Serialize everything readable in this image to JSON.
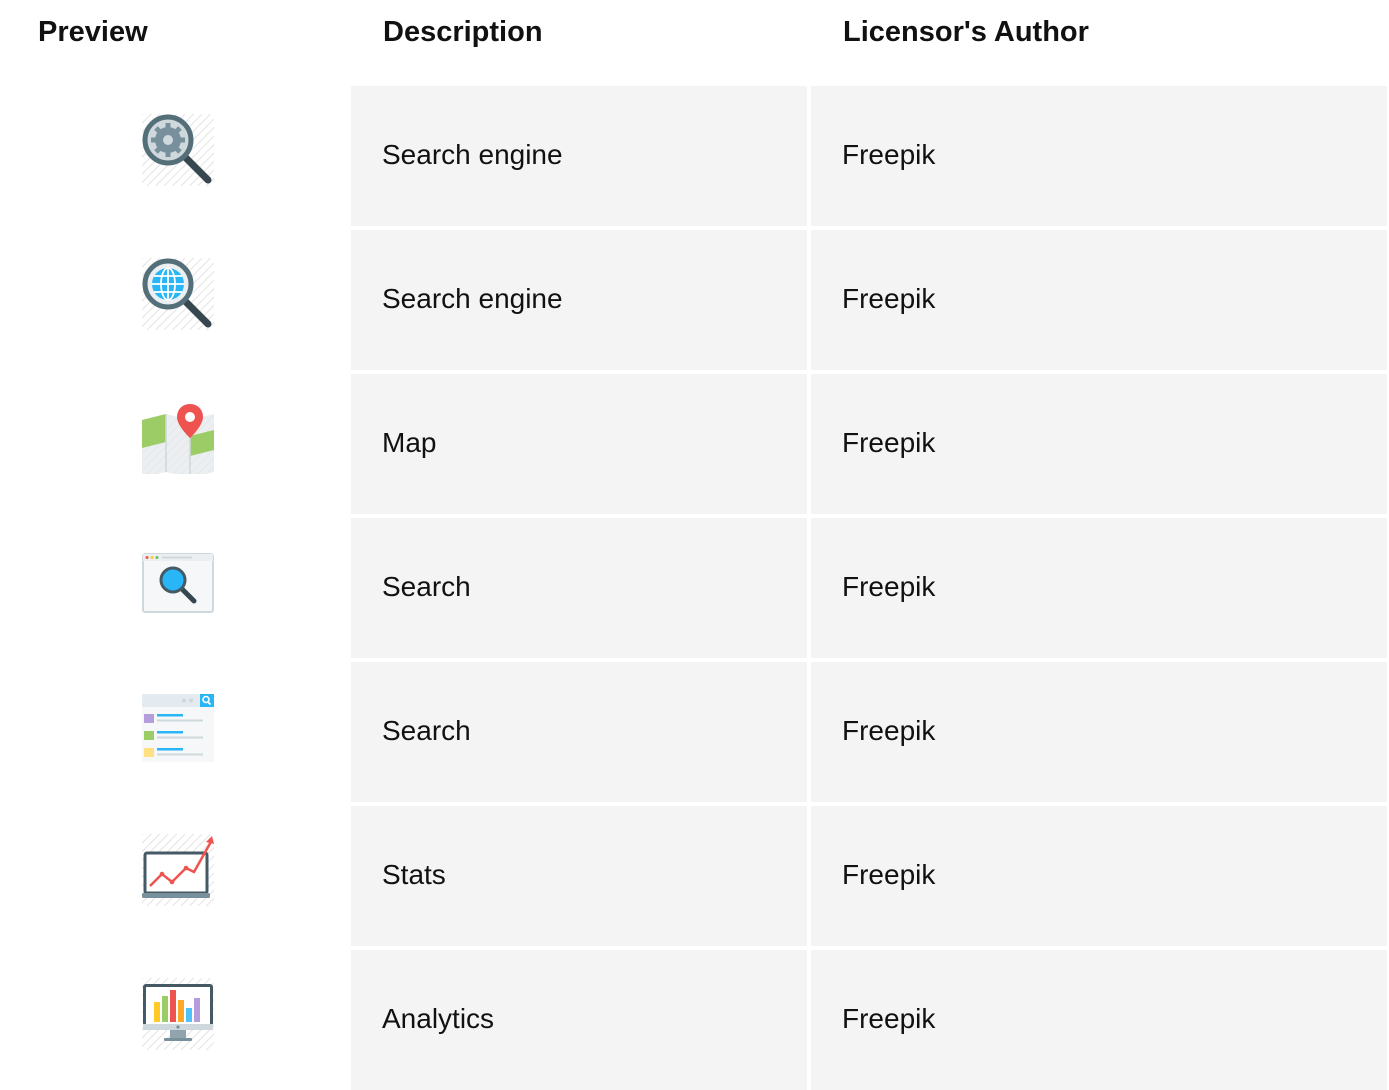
{
  "table": {
    "headers": {
      "preview": "Preview",
      "description": "Description",
      "author": "Licensor's Author"
    },
    "rows": [
      {
        "icon": "search-gear-icon",
        "description": "Search engine",
        "author": "Freepik"
      },
      {
        "icon": "search-globe-icon",
        "description": "Search engine",
        "author": "Freepik"
      },
      {
        "icon": "map-pin-icon",
        "description": "Map",
        "author": "Freepik"
      },
      {
        "icon": "browser-search-icon",
        "description": "Search",
        "author": "Freepik"
      },
      {
        "icon": "search-results-icon",
        "description": "Search",
        "author": "Freepik"
      },
      {
        "icon": "laptop-stats-icon",
        "description": "Stats",
        "author": "Freepik"
      },
      {
        "icon": "monitor-analytics-icon",
        "description": "Analytics",
        "author": "Freepik"
      }
    ]
  },
  "colors": {
    "cell_background": "#f4f4f4",
    "accent_blue": "#29b6f6",
    "accent_red": "#ef5350",
    "dark": "#37474f"
  }
}
